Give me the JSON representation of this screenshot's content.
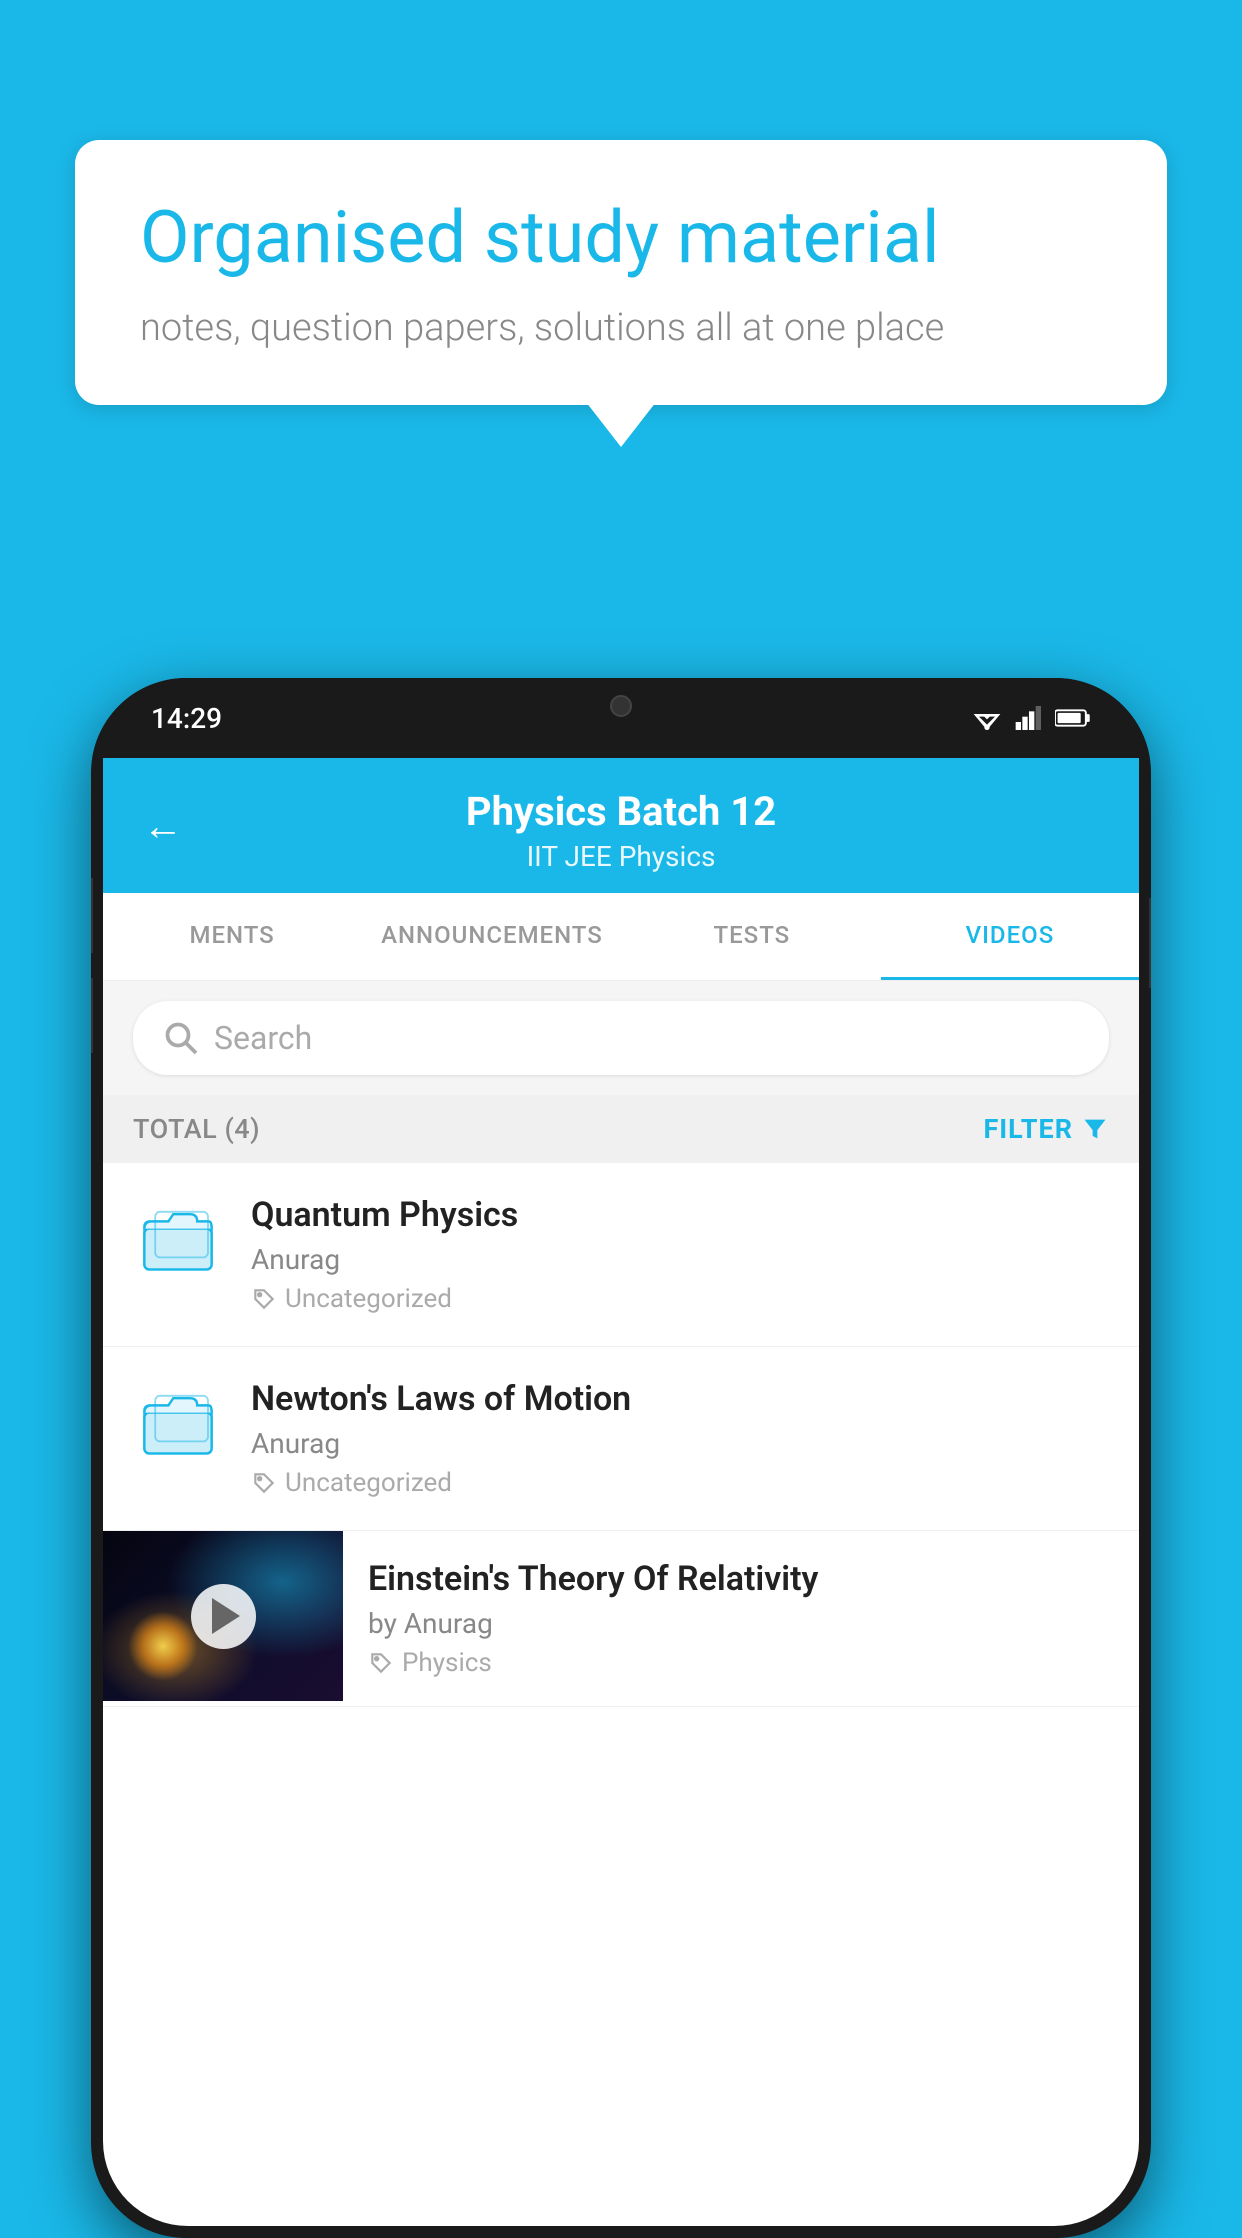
{
  "background_color": "#1ab8e8",
  "speech_bubble": {
    "headline": "Organised study material",
    "subtext": "notes, question papers, solutions all at one place"
  },
  "phone": {
    "status_bar": {
      "time": "14:29"
    },
    "app_header": {
      "title": "Physics Batch 12",
      "subtitle": "IIT JEE   Physics",
      "back_label": "←"
    },
    "tabs": [
      {
        "label": "MENTS",
        "active": false
      },
      {
        "label": "ANNOUNCEMENTS",
        "active": false
      },
      {
        "label": "TESTS",
        "active": false
      },
      {
        "label": "VIDEOS",
        "active": true
      }
    ],
    "search": {
      "placeholder": "Search"
    },
    "filter_row": {
      "total_label": "TOTAL (4)",
      "filter_label": "FILTER"
    },
    "videos": [
      {
        "id": 1,
        "title": "Quantum Physics",
        "author": "Anurag",
        "tag": "Uncategorized",
        "type": "folder"
      },
      {
        "id": 2,
        "title": "Newton's Laws of Motion",
        "author": "Anurag",
        "tag": "Uncategorized",
        "type": "folder"
      },
      {
        "id": 3,
        "title": "Einstein's Theory Of Relativity",
        "author": "by Anurag",
        "tag": "Physics",
        "type": "video"
      }
    ]
  }
}
